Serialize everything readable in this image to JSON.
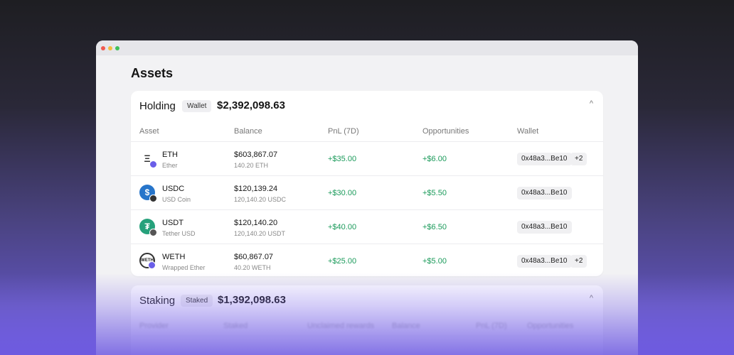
{
  "page": {
    "title": "Assets"
  },
  "holding": {
    "title": "Holding",
    "badge": "Wallet",
    "total": "$2,392,098.63",
    "columns": [
      "Asset",
      "Balance",
      "PnL (7D)",
      "Opportunities",
      "Wallet"
    ],
    "rows": [
      {
        "symbol": "ETH",
        "name": "Ether",
        "balance": "$603,867.07",
        "balance_sub": "140.20 ETH",
        "pnl": "+$35.00",
        "opportunities": "+$6.00",
        "wallet": "0x48a3...Be10",
        "more": "+2",
        "icon": "eth-icon"
      },
      {
        "symbol": "USDC",
        "name": "USD Coin",
        "balance": "$120,139.24",
        "balance_sub": "120,140.20 USDC",
        "pnl": "+$30.00",
        "opportunities": "+$5.50",
        "wallet": "0x48a3...Be10",
        "more": "",
        "icon": "usdc-icon"
      },
      {
        "symbol": "USDT",
        "name": "Tether USD",
        "balance": "$120,140.20",
        "balance_sub": "120,140.20 USDT",
        "pnl": "+$40.00",
        "opportunities": "+$6.50",
        "wallet": "0x48a3...Be10",
        "more": "",
        "icon": "usdt-icon"
      },
      {
        "symbol": "WETH",
        "name": "Wrapped Ether",
        "balance": "$60,867.07",
        "balance_sub": "40.20 WETH",
        "pnl": "+$25.00",
        "opportunities": "+$5.00",
        "wallet": "0x48a3...Be10",
        "more": "+2",
        "icon": "weth-icon"
      }
    ]
  },
  "staking": {
    "title": "Staking",
    "badge": "Staked",
    "total": "$1,392,098.63",
    "columns": [
      "Provider",
      "Staked",
      "Unclaimed rewards",
      "Balance",
      "PnL (7D)",
      "Opportunities"
    ]
  },
  "icons": {
    "eth": "Ξ",
    "usdc": "$",
    "usdt": "₮",
    "weth": "WETH",
    "chevron": "^"
  },
  "colors": {
    "positive": "#1a9a5a",
    "accent": "#6a5bd8"
  }
}
